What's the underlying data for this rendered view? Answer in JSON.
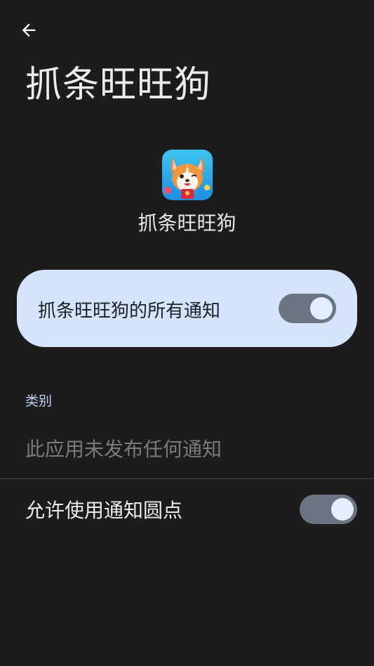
{
  "header": {
    "back_icon": "arrow-left-icon",
    "title": "抓条旺旺狗"
  },
  "app": {
    "icon": "corgi-app-icon",
    "name": "抓条旺旺狗"
  },
  "master_toggle": {
    "label": "抓条旺旺狗的所有通知",
    "state": "on"
  },
  "categories": {
    "header": "类别",
    "empty_message": "此应用未发布任何通知"
  },
  "notification_dot": {
    "label": "允许使用通知圆点",
    "state": "on"
  },
  "colors": {
    "background": "#1c1c1c",
    "card": "#d5e3fb",
    "toggle_track": "#6b7481",
    "toggle_thumb": "#e4eeff",
    "accent_text": "#b8cdf0"
  }
}
